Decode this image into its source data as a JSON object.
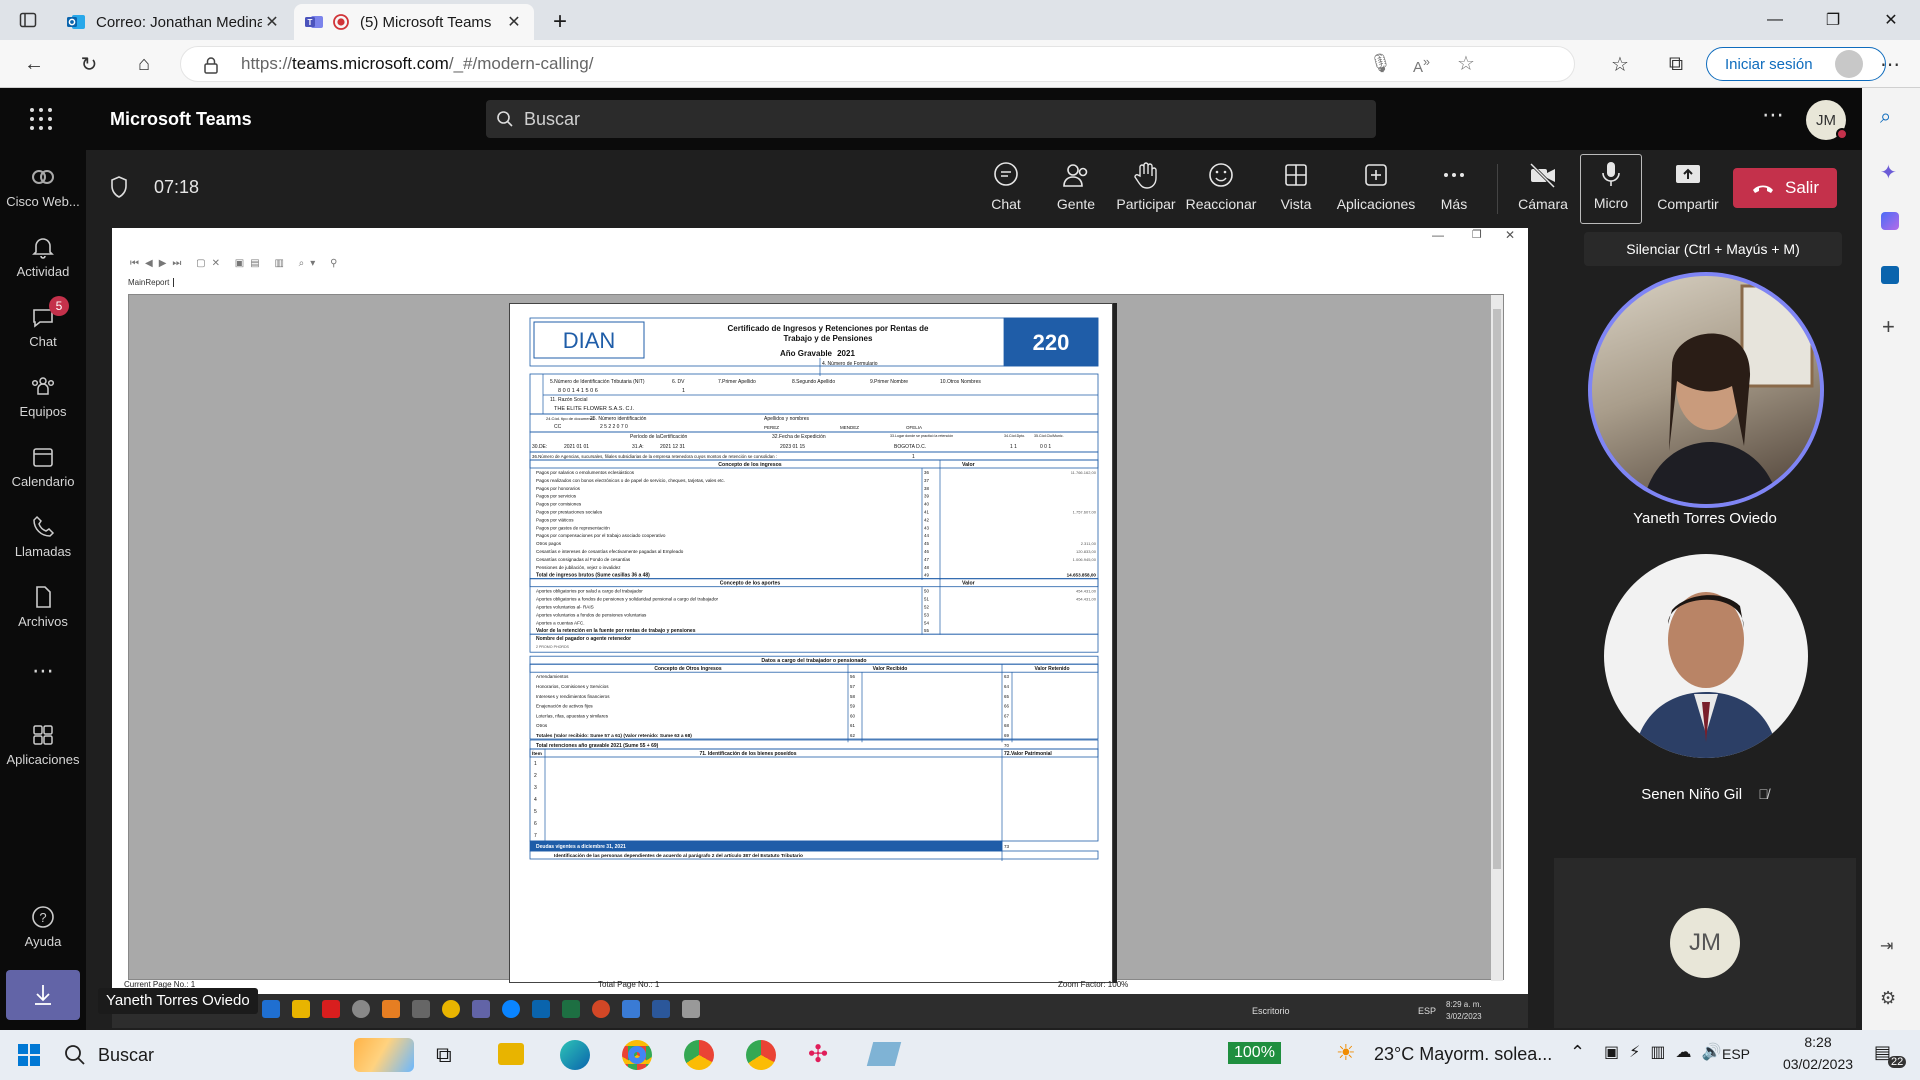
{
  "browser": {
    "tabs": [
      {
        "label": "Correo: Jonathan Medina - Outlo",
        "active": false
      },
      {
        "label": "(5) Microsoft Teams",
        "active": true
      }
    ],
    "url_prefix": "https://",
    "url_host": "teams.microsoft.com",
    "url_path": "/_#/modern-calling/",
    "sign_in_label": "Iniciar sesión"
  },
  "teams": {
    "app_title": "Microsoft Teams",
    "search_placeholder": "Buscar",
    "user_initials": "JM",
    "call_timer": "07:18",
    "rail": [
      {
        "label": "Cisco Web...",
        "icon": "cisco-webex-icon"
      },
      {
        "label": "Actividad",
        "icon": "bell-icon"
      },
      {
        "label": "Chat",
        "icon": "chat-icon",
        "badge": "5"
      },
      {
        "label": "Equipos",
        "icon": "teams-icon"
      },
      {
        "label": "Calendario",
        "icon": "calendar-icon"
      },
      {
        "label": "Llamadas",
        "icon": "phone-icon"
      },
      {
        "label": "Archivos",
        "icon": "file-icon"
      },
      {
        "label": "Aplicaciones",
        "icon": "apps-icon"
      },
      {
        "label": "Ayuda",
        "icon": "help-icon"
      }
    ],
    "toolbar": {
      "chat": "Chat",
      "people": "Gente",
      "raise": "Participar",
      "react": "Reaccionar",
      "view": "Vista",
      "apps": "Aplicaciones",
      "more": "Más",
      "camera": "Cámara",
      "mic": "Micro",
      "share": "Compartir",
      "leave": "Salir"
    },
    "mic_tooltip": "Silenciar (Ctrl + Mayús + M)",
    "participants": [
      {
        "name": "Yaneth Torres Oviedo",
        "speaking": true
      },
      {
        "name": "Senen Niño Gil",
        "muted": true
      },
      {
        "name": "",
        "initials": "JM"
      }
    ],
    "presenter_label": "Yaneth Torres Oviedo"
  },
  "report": {
    "tab_label": "MainReport",
    "status_current": "Current Page No.: 1",
    "status_total": "Total Page No.: 1",
    "status_zoom": "Zoom Factor: 100%",
    "form": {
      "logo": "DIAN",
      "title_1": "Certificado de Ingresos y Retenciones por Rentas de",
      "title_2": "Trabajo y de Pensiones",
      "year_label": "Año Gravable",
      "year": "2021",
      "number": "220",
      "form_no_label": "4. Número de Formulario",
      "nit_label": "5.Número de Identificación Tributaria (NIT)",
      "dv_label": "6. DV",
      "ap1_label": "7.Primer Apellido",
      "ap2_label": "8.Segundo Apellido",
      "nom1_label": "9.Primer Nombre",
      "nom2_label": "10.Otros Nombres",
      "nit": "8 0 0 1 4 1 5 0 6",
      "dv": "1",
      "razon_label": "11. Razón Social",
      "razon": "THE ELITE FLOWER S.A.S. C.I.",
      "doc_label": "24.Cód. tipo de documento",
      "doc_type": "CC",
      "id_label": "25. Número identificación",
      "id_number": "2  5  2  2  0  7  0",
      "names_label": "Apellidos y nombres",
      "name_1": "PEREZ",
      "name_2": "MENDEZ",
      "name_3": "OFELIA",
      "period_label": "Período de laCertificación",
      "de_label": "30.DE:",
      "de_value": "2021   01   01",
      "a_label": "31.A:",
      "a_value": "2021   12   31",
      "exp_label": "32.Fecha de Expedición",
      "exp_value": "2023   01   15",
      "place_label": "33.Lugar donde se practicó la retención",
      "place_value": "BOGOTA D.C.",
      "dpto_label": "34.Cód.Dpto.",
      "dpto_value": "1  1",
      "mun_label": "35.Cód.Ciu/Munic.",
      "mun_value": "0  0  1",
      "agencies_label": "36.Número de Agencias, sucursales, filiales subsidiarias de la empresa retenedora cuyos montos de retención se consolidan :",
      "agencies_value": "1",
      "income_header": "Concepto de los ingresos",
      "value_header": "Valor",
      "income": [
        {
          "label": "Pagos por salarios o emolumentos eclesiásticos",
          "code": "36",
          "value": "11.766.162,00"
        },
        {
          "label": "Pagos realizados con bonos electrónicos o de papel de servicio, cheques, tarjetas, vales etc.",
          "code": "37",
          "value": ""
        },
        {
          "label": "Pagos por honorarios",
          "code": "38",
          "value": ""
        },
        {
          "label": "Pagos por servicios",
          "code": "39",
          "value": ""
        },
        {
          "label": "Pagos por comisiones",
          "code": "40",
          "value": ""
        },
        {
          "label": "Pagos por prestaciones sociales",
          "code": "41",
          "value": "1.757.607,00"
        },
        {
          "label": "Pagos por viáticos",
          "code": "42",
          "value": ""
        },
        {
          "label": "Pagos por gastos de representación",
          "code": "43",
          "value": ""
        },
        {
          "label": "Pagos por compensaciones por el trabajo asociado cooperativo",
          "code": "44",
          "value": ""
        },
        {
          "label": "Otros pagos",
          "code": "45",
          "value": "2.311,00"
        },
        {
          "label": "Cesantías e intereses de cesantías efectivamente pagadas al Empleado",
          "code": "46",
          "value": "120.833,00"
        },
        {
          "label": "Cesantías consignadas al Fondo de cesantías",
          "code": "47",
          "value": "1.006.945,00"
        },
        {
          "label": "Pensiones de jubilación, vejez o invalidez",
          "code": "48",
          "value": ""
        }
      ],
      "income_total_label": "Total de ingresos brutos (Sume casillas 36 a 48)",
      "income_total_code": "49",
      "income_total": "14.653.858,00",
      "contrib_header": "Concepto de los aportes",
      "contrib": [
        {
          "label": "Aportes obligatorios por salud a cargo del trabajador",
          "code": "50",
          "value": "454.431,00"
        },
        {
          "label": "Aportes obligatorios a fondos de pensiones y solidaridad pensional a cargo del trabajador",
          "code": "51",
          "value": "454.431,00"
        },
        {
          "label": "Aportes voluntarios al- RAIS",
          "code": "52",
          "value": ""
        },
        {
          "label": "Aportes voluntarios a fondos de pensiones voluntarias",
          "code": "53",
          "value": ""
        },
        {
          "label": "Aportes a cuentas AFC.",
          "code": "54",
          "value": ""
        }
      ],
      "withholding_label": "Valor de la retención en la fuente por rentas de trabajo y pensiones",
      "withholding_code": "55",
      "payer_label": "Nombre del pagador o agente retenedor",
      "payer_value": "2 PROMO PHORDS",
      "worker_header": "Datos a cargo del trabajador o pensionado",
      "other_header": "Concepto de Otros Ingresos",
      "received_header": "Valor Recibido",
      "retained_header": "Valor Retenido",
      "other": [
        {
          "label": "Arrendamientos",
          "c1": "56",
          "c2": "63"
        },
        {
          "label": "Honorarios, Comisiones y Servicios",
          "c1": "57",
          "c2": "64"
        },
        {
          "label": "Intereses y rendimientos financieros",
          "c1": "58",
          "c2": "65"
        },
        {
          "label": "Enajenación de activos fijos",
          "c1": "59",
          "c2": "66"
        },
        {
          "label": "Loterías, rifas, apuestas y similares",
          "c1": "60",
          "c2": "67"
        },
        {
          "label": "Otros",
          "c1": "61",
          "c2": "68"
        }
      ],
      "other_total_label": "Totales (Valor recibido: Sume 57 a 61) (Valor retenido: Sume 63 a 68)",
      "other_total_c1": "62",
      "other_total_c2": "69",
      "ret_total_label": "Total retenciones año gravable    2021   (Sume 55 + 69)",
      "ret_total_code": "70",
      "item_label": "Ítem",
      "assets_label": "71.  Identificación de los bienes poseídos",
      "assets_value_label": "72.Valor Patrimonial",
      "asset_items": [
        "1",
        "2",
        "3",
        "4",
        "5",
        "6",
        "7"
      ],
      "debts_label": "Deudas vigentes a    diciembre 31, 2021",
      "debts_code": "73",
      "dependents_label": "Identificación de las personas dependientes de acuerdo al parágrafo 2 del artículo 387 del Estatuto Tributario"
    }
  },
  "remote_taskbar": {
    "desktop_label": "Escritorio",
    "lang": "ESP",
    "time": "8:29 a. m.",
    "date": "3/02/2023"
  },
  "taskbar": {
    "search_label": "Buscar",
    "battery": "100%",
    "weather": "23°C  Mayorm. solea...",
    "lang": "ESP",
    "time": "8:28",
    "date": "03/02/2023",
    "notif_count": "22"
  },
  "colors": {
    "teams_accent": "#7f85f5",
    "leave_red": "#c4314b",
    "dian_blue": "#1f5da8",
    "edge_blue": "#0f6cbd"
  }
}
